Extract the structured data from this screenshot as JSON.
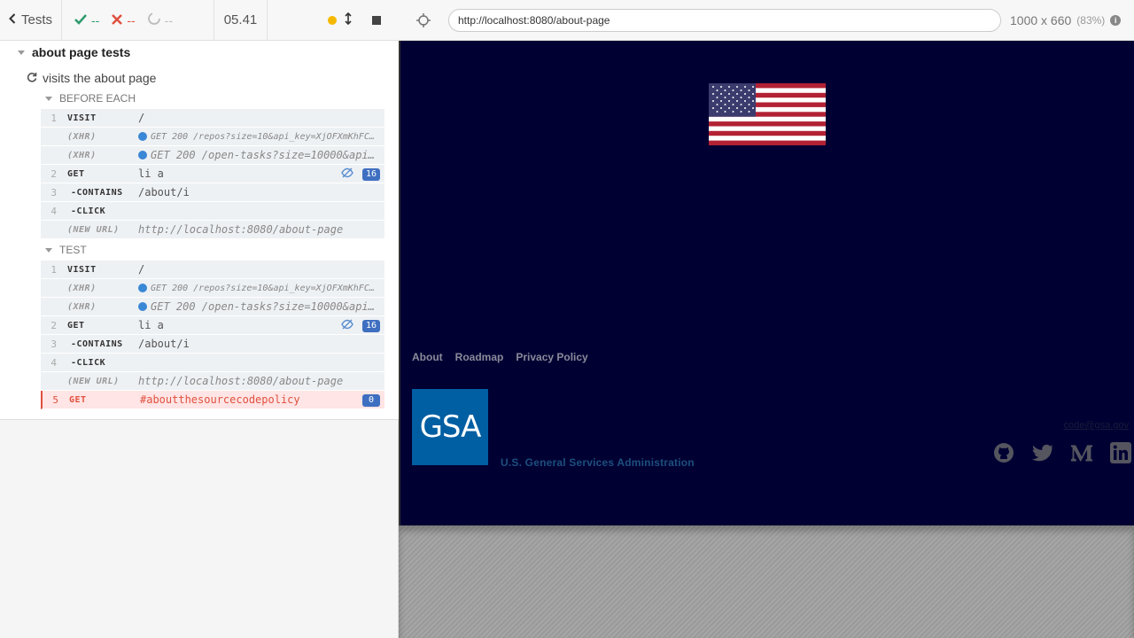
{
  "reporter": {
    "header": {
      "tests_label": "Tests",
      "passed": "--",
      "failed": "--",
      "pending": "--",
      "timer": "05.41"
    },
    "suite": {
      "title": "about page tests",
      "test_title": "visits the about page",
      "before_each": {
        "label": "BEFORE EACH",
        "commands": [
          {
            "num": "1",
            "name": "VISIT",
            "msg": "/"
          },
          {
            "num": "",
            "name": "(XHR)",
            "msg": "GET 200 /repos?size=10&api_key=XjOFXmKhFC…"
          },
          {
            "num": "",
            "name": "(XHR)",
            "msg": "GET 200 /open-tasks?size=10000&api…"
          },
          {
            "num": "2",
            "name": "GET",
            "msg": "li a",
            "badge": "16"
          },
          {
            "num": "3",
            "name": "-CONTAINS",
            "msg": "/about/i"
          },
          {
            "num": "4",
            "name": "-CLICK",
            "msg": ""
          },
          {
            "num": "",
            "name": "(NEW URL)",
            "msg": "http://localhost:8080/about-page"
          }
        ]
      },
      "test": {
        "label": "TEST",
        "commands": [
          {
            "num": "1",
            "name": "VISIT",
            "msg": "/"
          },
          {
            "num": "",
            "name": "(XHR)",
            "msg": "GET 200 /repos?size=10&api_key=XjOFXmKhFC…"
          },
          {
            "num": "",
            "name": "(XHR)",
            "msg": "GET 200 /open-tasks?size=10000&api…"
          },
          {
            "num": "2",
            "name": "GET",
            "msg": "li a",
            "badge": "16"
          },
          {
            "num": "3",
            "name": "-CONTAINS",
            "msg": "/about/i"
          },
          {
            "num": "4",
            "name": "-CLICK",
            "msg": ""
          },
          {
            "num": "",
            "name": "(NEW URL)",
            "msg": "http://localhost:8080/about-page"
          },
          {
            "num": "5",
            "name": "GET",
            "msg": "#aboutthesourcecodepolicy",
            "badge": "0"
          }
        ]
      }
    }
  },
  "aut": {
    "url": "http://localhost:8080/about-page",
    "viewport": "1000 x 660",
    "scale": "(83%)",
    "footer_links": [
      "About",
      "Roadmap",
      "Privacy Policy"
    ],
    "gsa_logo": "GSA",
    "gsa_name": "U.S. General Services Administration",
    "contact_email": "code@gsa.gov",
    "social_icons": [
      "github-icon",
      "twitter-icon",
      "medium-icon",
      "linkedin-icon"
    ]
  },
  "colors": {
    "aut_bg": "#000033",
    "pass": "#2e9b6b",
    "fail": "#e0503e",
    "badge": "#3f6fc0",
    "gsa_blue": "#005ea2"
  }
}
